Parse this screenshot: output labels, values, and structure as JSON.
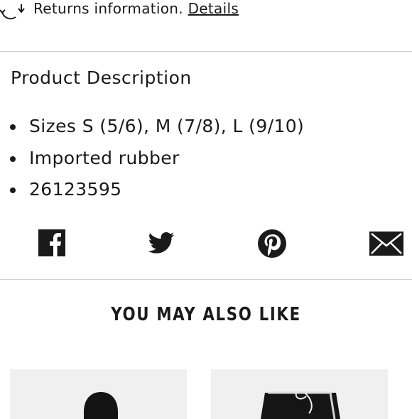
{
  "returns": {
    "text": "Returns information.",
    "link_label": "Details",
    "icon": "returns-cycle-icon"
  },
  "description": {
    "title": "Product Description",
    "items": [
      "Sizes S (5/6), M (7/8), L (9/10)",
      "Imported rubber",
      "26123595"
    ]
  },
  "share": {
    "icons": [
      "facebook-icon",
      "twitter-icon",
      "pinterest-icon",
      "email-icon"
    ]
  },
  "recommendations": {
    "title": "YOU MAY ALSO LIKE",
    "cards": [
      {
        "image": "black-hat-image"
      },
      {
        "image": "black-shorts-image"
      }
    ]
  },
  "colors": {
    "text": "#1a1a1a",
    "divider": "#cfcfcf",
    "card_bg": "#f0f0f0"
  }
}
